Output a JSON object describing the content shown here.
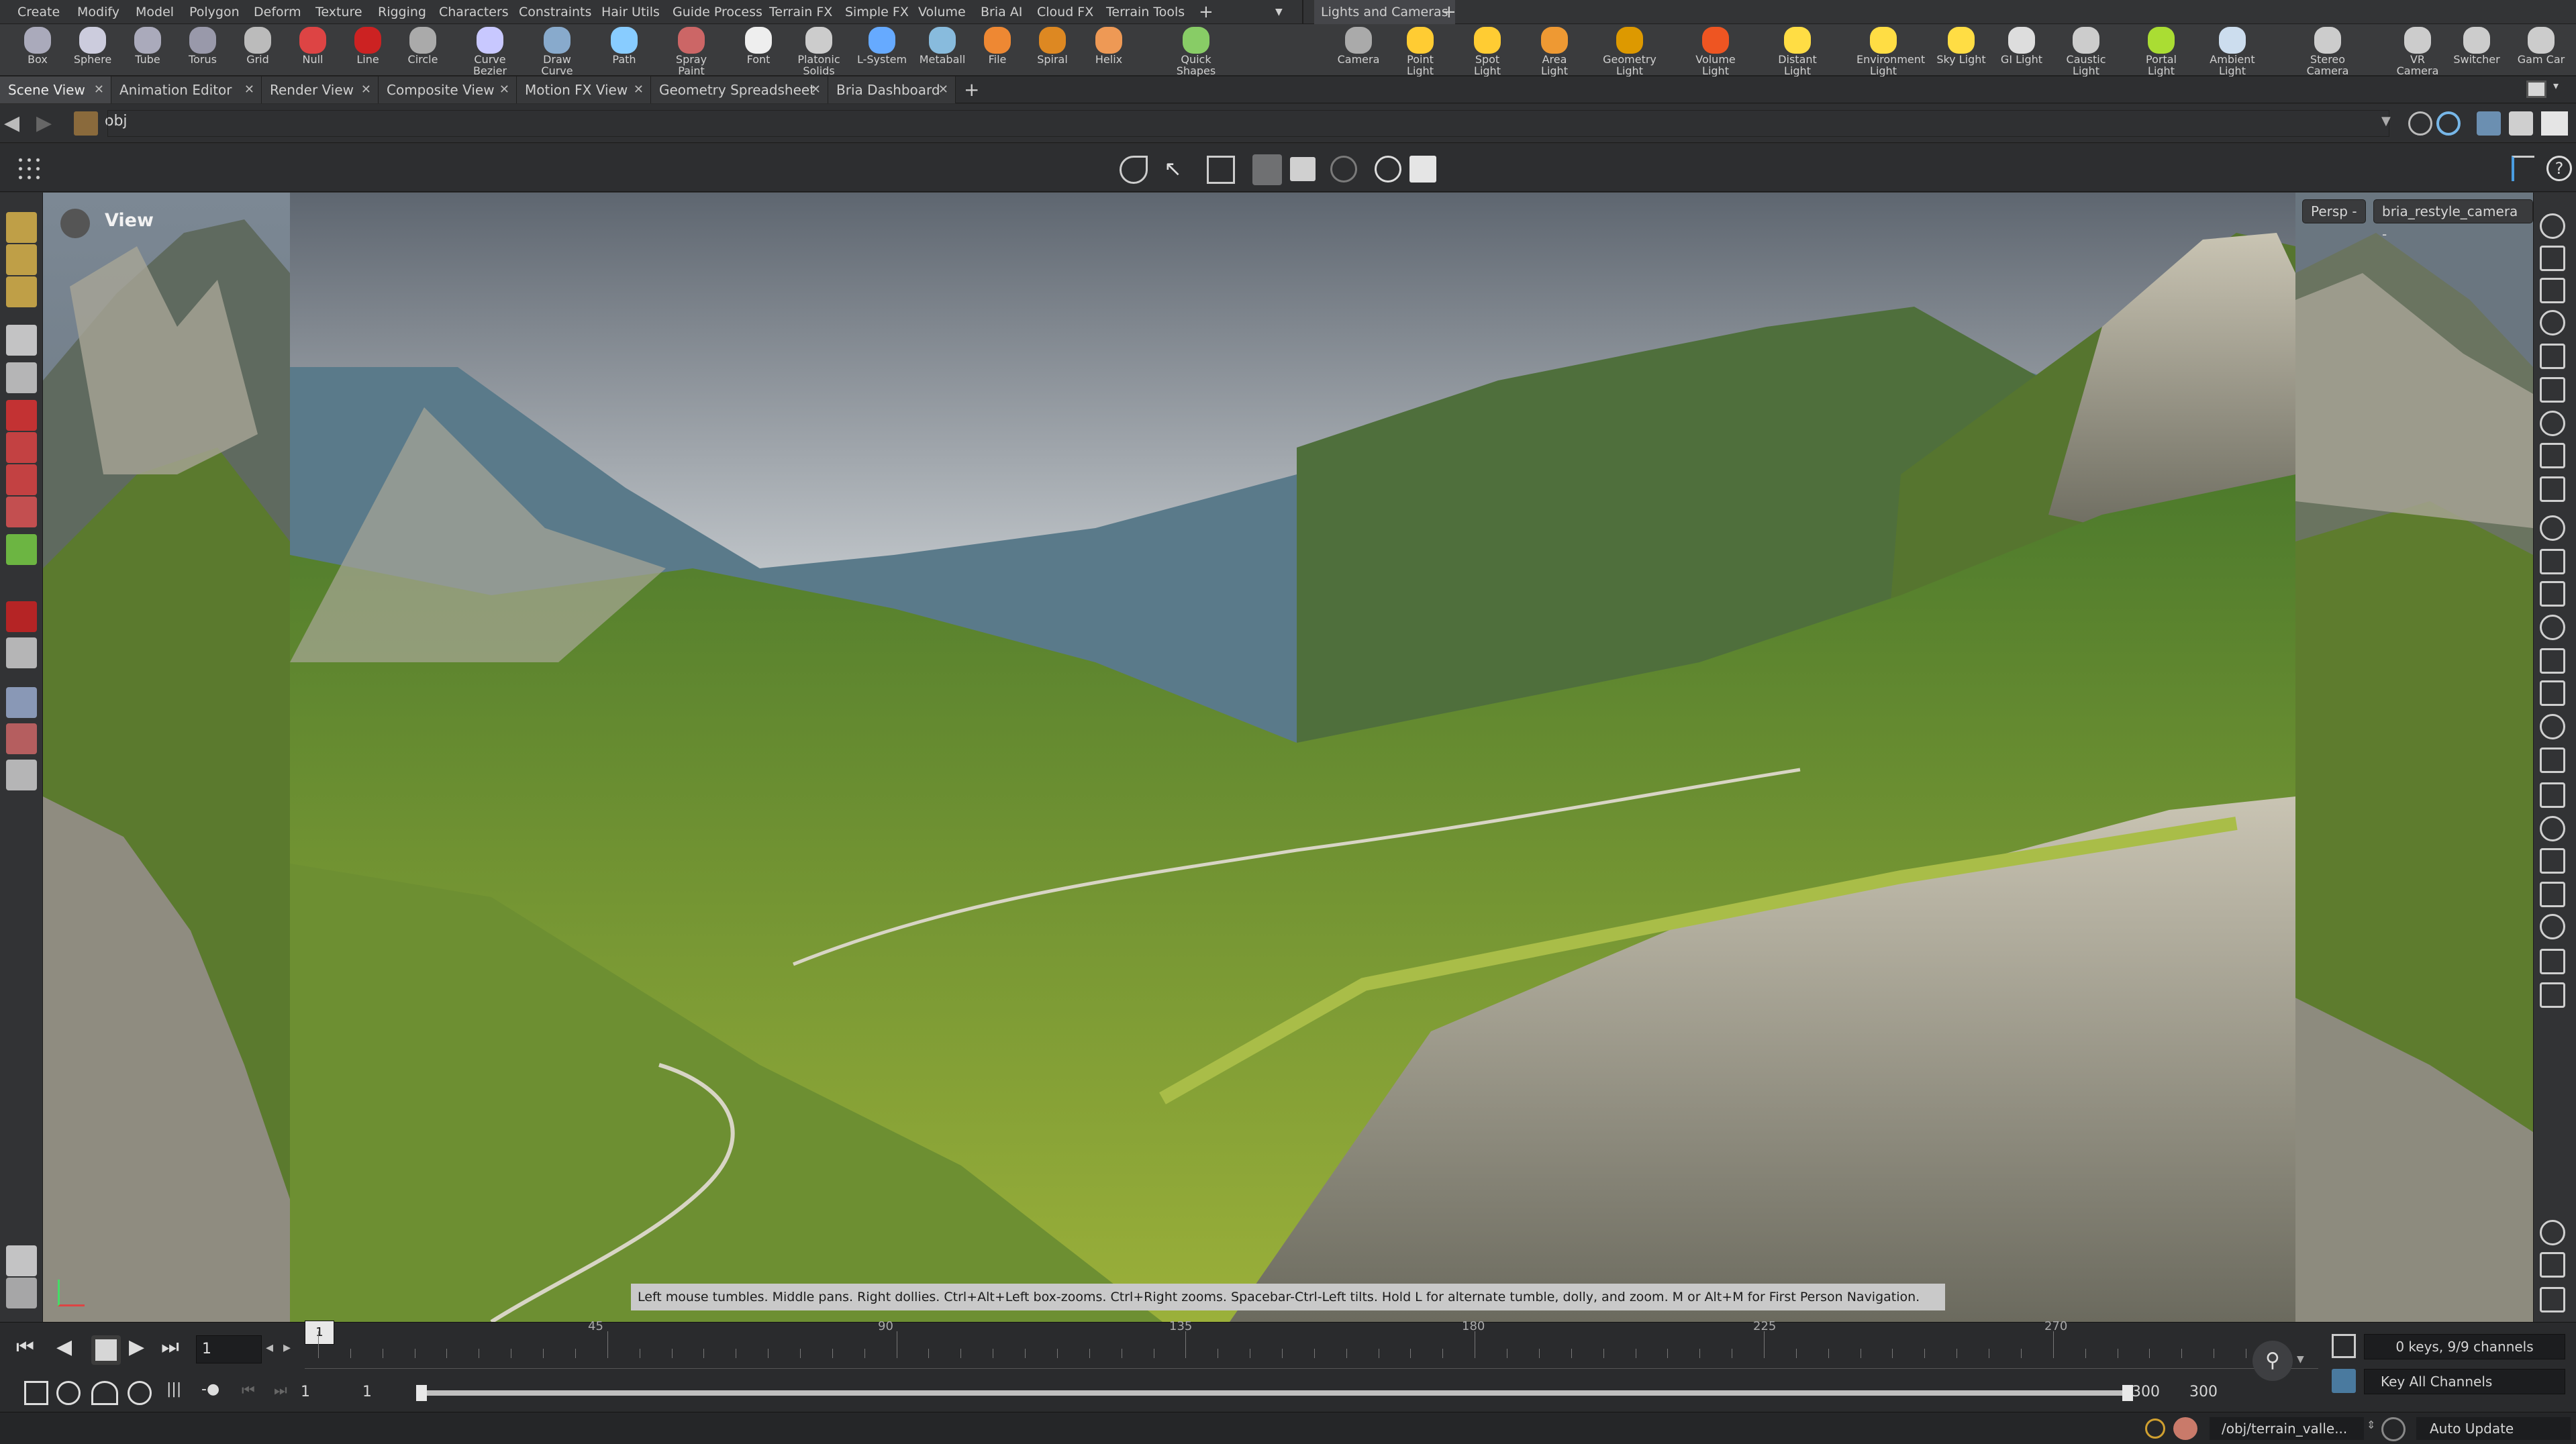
{
  "menu": [
    "Create",
    "Modify",
    "Model",
    "Polygon",
    "Deform",
    "Texture",
    "Rigging",
    "Characters",
    "Constraints",
    "Hair Utils",
    "Guide Process",
    "Terrain FX",
    "Simple FX",
    "Volume",
    "Bria AI",
    "Cloud FX",
    "Terrain Tools"
  ],
  "menu_right_tab": "Lights and Cameras",
  "shelf_left": [
    "Box",
    "Sphere",
    "Tube",
    "Torus",
    "Grid",
    "Null",
    "Line",
    "Circle",
    "Curve Bezier",
    "Draw Curve",
    "Path",
    "Spray Paint",
    "Font",
    "Platonic Solids",
    "L-System",
    "Metaball",
    "File",
    "Spiral",
    "Helix",
    "Quick Shapes"
  ],
  "shelf_right": [
    "Camera",
    "Point Light",
    "Spot Light",
    "Area Light",
    "Geometry Light",
    "Volume Light",
    "Distant Light",
    "Environment Light",
    "Sky Light",
    "GI Light",
    "Caustic Light",
    "Portal Light",
    "Ambient Light",
    "Stereo Camera",
    "VR Camera",
    "Switcher",
    "Gam Car"
  ],
  "pane_tabs": [
    "Scene View",
    "Animation Editor",
    "Render View",
    "Composite View",
    "Motion FX View",
    "Geometry Spreadsheet",
    "Bria Dashboard"
  ],
  "path": "obj",
  "viewport": {
    "label": "View",
    "persp": "Persp",
    "camera": "bria_restyle_camera",
    "hint": "Left mouse tumbles. Middle pans. Right dollies. Ctrl+Alt+Left box-zooms. Ctrl+Right zooms. Spacebar-Ctrl-Left tilts. Hold L for alternate tumble, dolly, and zoom. M or Alt+M for First Person Navigation."
  },
  "timeline": {
    "current_frame": "1",
    "ticks": [
      "1",
      "45",
      "90",
      "135",
      "180",
      "225",
      "270"
    ],
    "start": "1",
    "start2": "1",
    "end": "300",
    "end2": "300",
    "keys": "0 keys, 9/9 channels",
    "key_all": "Key All Channels"
  },
  "status": {
    "path": "/obj/terrain_valle...",
    "update": "Auto Update"
  }
}
